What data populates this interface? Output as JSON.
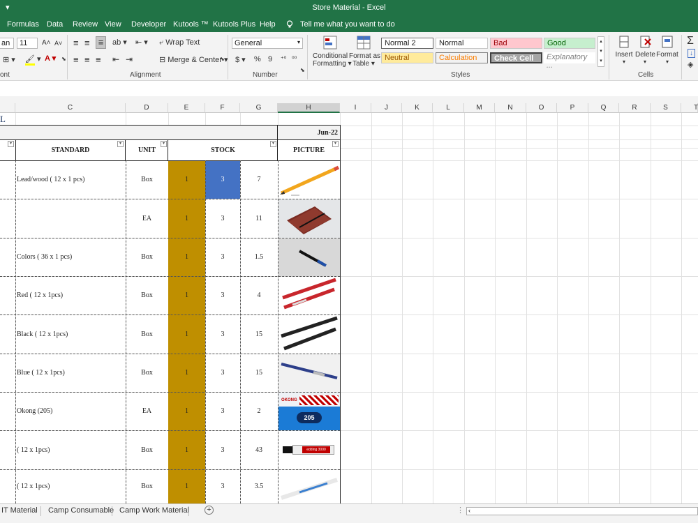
{
  "window": {
    "title": "Store Material  -  Excel",
    "quick_access": "▾"
  },
  "menu": [
    "Formulas",
    "Data",
    "Review",
    "View",
    "Developer",
    "Kutools ™",
    "Kutools Plus",
    "Help"
  ],
  "tell_me": "Tell me what you want to do",
  "ribbon": {
    "font_name": "an",
    "font_size": "11",
    "wrap_text": "Wrap Text",
    "merge_center": "Merge & Center",
    "number_format": "General",
    "currency": "$",
    "percent": "%",
    "comma": "9",
    "conditional_formatting": [
      "Conditional",
      "Formatting"
    ],
    "format_as_table": [
      "Format as",
      "Table"
    ],
    "styles": [
      {
        "label": "Normal 2",
        "bg": "#ffffff",
        "color": "#000000"
      },
      {
        "label": "Normal",
        "bg": "#ffffff",
        "color": "#000000"
      },
      {
        "label": "Bad",
        "bg": "#ffc7ce",
        "color": "#9c0006"
      },
      {
        "label": "Good",
        "bg": "#c6efce",
        "color": "#006100"
      },
      {
        "label": "Neutral",
        "bg": "#ffeb9c",
        "color": "#9c5700"
      },
      {
        "label": "Calculation",
        "bg": "#f2f2f2",
        "color": "#fa7d00"
      },
      {
        "label": "Check Cell",
        "bg": "#a5a5a5",
        "color": "#ffffff"
      },
      {
        "label": "Explanatory ...",
        "bg": "#ffffff",
        "color": "#7f7f7f"
      }
    ],
    "cells": [
      "Insert",
      "Delete",
      "Format"
    ],
    "groups": [
      "ont",
      "Alignment",
      "Number",
      "Styles",
      "Cells"
    ]
  },
  "columns": [
    "C",
    "D",
    "E",
    "F",
    "G",
    "H",
    "I",
    "J",
    "K",
    "L",
    "M",
    "N",
    "O",
    "P",
    "Q",
    "R",
    "S",
    "T"
  ],
  "sheet": {
    "a1_fragment": "L",
    "date": "Jun-22",
    "headers": {
      "standard": "STANDARD",
      "unit": "UNIT",
      "stock": "STOCK",
      "picture": "PICTURE"
    },
    "rows": [
      {
        "standard": "Lead/wood ( 12 x 1 pcs)",
        "unit": "Box",
        "e": "1",
        "f": "3",
        "g": "7",
        "picture": "pencil"
      },
      {
        "standard": "",
        "unit": "EA",
        "e": "1",
        "f": "3",
        "g": "11",
        "picture": "notebook"
      },
      {
        "standard": " Colors ( 36 x 1 pcs)",
        "unit": "Box",
        "e": "1",
        "f": "3",
        "g": "1.5",
        "picture": "pen"
      },
      {
        "standard": "Red ( 12 x 1pcs)",
        "unit": "Box",
        "e": "1",
        "f": "3",
        "g": "4",
        "picture": "red-pens"
      },
      {
        "standard": "Black ( 12 x 1pcs)",
        "unit": "Box",
        "e": "1",
        "f": "3",
        "g": "15",
        "picture": "black-pens"
      },
      {
        "standard": "Blue  ( 12 x 1pcs)",
        "unit": "Box",
        "e": "1",
        "f": "3",
        "g": "15",
        "picture": "blue-pen"
      },
      {
        "standard": "Okong (205)",
        "unit": "EA",
        "e": "1",
        "f": "3",
        "g": "2",
        "picture": "okong-205"
      },
      {
        "standard": "( 12 x 1pcs)",
        "unit": "Box",
        "e": "1",
        "f": "3",
        "g": "43",
        "picture": "marker"
      },
      {
        "standard": " ( 12 x 1pcs)",
        "unit": "Box",
        "e": "1",
        "f": "3",
        "g": "3.5",
        "picture": "highlighter"
      }
    ],
    "picture_texts": {
      "okong_brand": "OKONG",
      "okong_number": "205",
      "marker_brand": "edding 3000"
    }
  },
  "sheet_tabs": [
    "IT Material",
    "Camp Consumable",
    "Camp Work Material"
  ],
  "colors": {
    "excel_green": "#217346",
    "gold": "#bf8f00",
    "selected_blue": "#4472c4"
  }
}
